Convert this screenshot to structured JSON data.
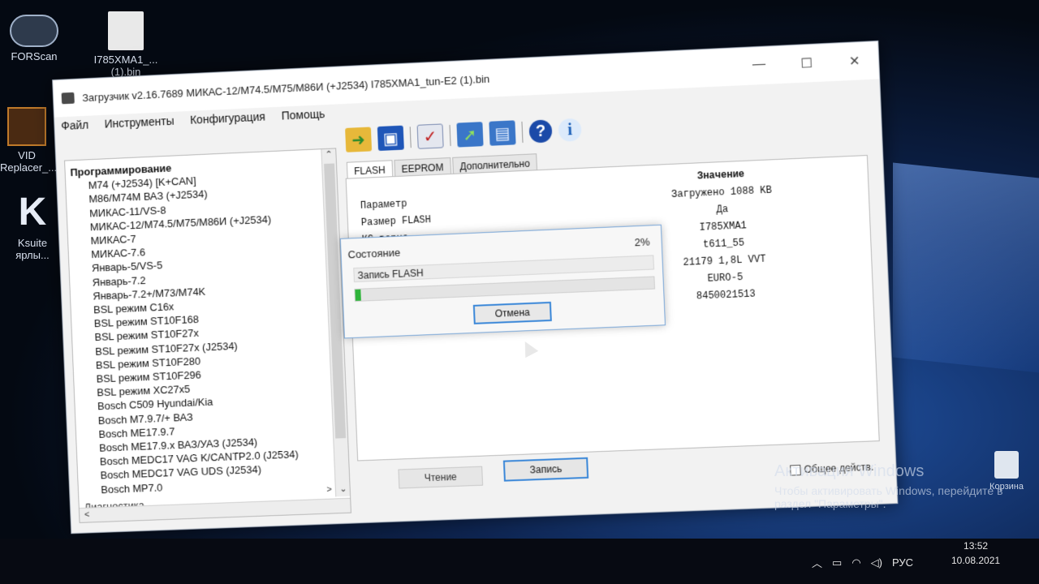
{
  "desktop": {
    "icons": [
      {
        "label": "FORScan"
      },
      {
        "label": "I785XMA1_...\n(1).bin"
      },
      {
        "label": "VID\nReplacer_..."
      },
      {
        "label": "Ksuite\nярлы..."
      }
    ],
    "activation_title": "Активация Windows",
    "activation_text": "Чтобы активировать Windows, перейдите в раздел \"Параметры\".",
    "recycle_label": "Корзина"
  },
  "window": {
    "title": "Загрузчик v2.16.7689 МИКАС-12/М74.5/М75/М86И (+J2534) I785XMA1_tun-E2 (1).bin",
    "controls": {
      "minimize": "—",
      "maximize": "☐",
      "close": "✕"
    },
    "menu": [
      "Файл",
      "Инструменты",
      "Конфигурация",
      "Помощь"
    ]
  },
  "tree": {
    "root": "Программирование",
    "items": [
      "M74 (+J2534) [K+CAN]",
      "M86/M74M ВАЗ (+J2534)",
      "МИКАС-11/VS-8",
      "МИКАС-12/М74.5/М75/М86И (+J2534)",
      "МИКАС-7",
      "МИКАС-7.6",
      "Январь-5/VS-5",
      "Январь-7.2",
      "Январь-7.2+/M73/M74K",
      "BSL режим C16x",
      "BSL режим ST10F168",
      "BSL режим ST10F27x",
      "BSL режим ST10F27x (J2534)",
      "BSL режим ST10F280",
      "BSL режим ST10F296",
      "BSL режим XC27x5",
      "Bosch C509 Hyundai/Kia",
      "Bosch M7.9.7/+ ВАЗ",
      "Bosch ME17.9.7",
      "Bosch ME17.9.x ВАЗ/УАЗ (J2534)",
      "Bosch MEDC17 VAG K/CANTP2.0 (J2534)",
      "Bosch MEDC17 VAG UDS (J2534)",
      "Bosch MP7.0"
    ],
    "next_root": "Диагностика"
  },
  "toolbar": {
    "icons": [
      "open-folder-icon",
      "save-icon",
      "check-icon",
      "write-icon",
      "write-all-icon",
      "help-icon",
      "info-icon"
    ],
    "help_glyph": "?",
    "info_glyph": "i"
  },
  "tabs": [
    "FLASH",
    "EEPROM",
    "Дополнительно"
  ],
  "params": {
    "header_param": "Параметр",
    "header_value": "Значение",
    "rows": [
      {
        "name": "Размер FLASH",
        "value": "Загружено 1088 KB"
      },
      {
        "name": "КС верна",
        "value": "Да"
      },
      {
        "name": "",
        "value": "I785XMA1"
      },
      {
        "name": "",
        "value": "t611_55"
      },
      {
        "name": "",
        "value": "21179 1,8L VVT"
      },
      {
        "name": "",
        "value": "EURO-5"
      },
      {
        "name": "",
        "value": "8450021513"
      }
    ]
  },
  "buttons": {
    "read": "Чтение",
    "write": "Запись"
  },
  "common_action": "Общее действ.",
  "dialog": {
    "title": "Состояние",
    "percent_label": "2%",
    "progress": 0.02,
    "status": "Запись FLASH",
    "cancel": "Отмена"
  },
  "taskbar": {
    "lang": "РУС",
    "time": "13:52",
    "date": "10.08.2021"
  }
}
